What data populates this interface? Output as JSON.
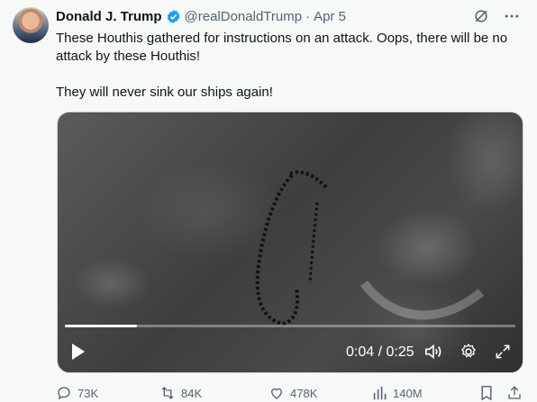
{
  "tweet": {
    "author_name": "Donald J. Trump",
    "handle": "@realDonaldTrump",
    "separator": "·",
    "date": "Apr 5",
    "paragraph_1": "These Houthis gathered for instructions on an attack. Oops, there will be no attack by these Houthis!",
    "paragraph_2": "They will never sink our ships again!"
  },
  "video": {
    "time_display": "0:04 / 0:25",
    "progress": 0.16
  },
  "actions": {
    "replies": "73K",
    "reposts": "84K",
    "likes": "478K",
    "views": "140M"
  },
  "icons": [
    "verified-badge-icon",
    "grok-icon",
    "more-icon",
    "play-icon",
    "volume-icon",
    "settings-icon",
    "fullscreen-icon",
    "reply-icon",
    "repost-icon",
    "like-icon",
    "views-icon",
    "bookmark-icon",
    "share-icon"
  ],
  "colors": {
    "verified_blue": "#1d9bf0",
    "muted_text": "#536471",
    "background": "#f7f9f9"
  }
}
